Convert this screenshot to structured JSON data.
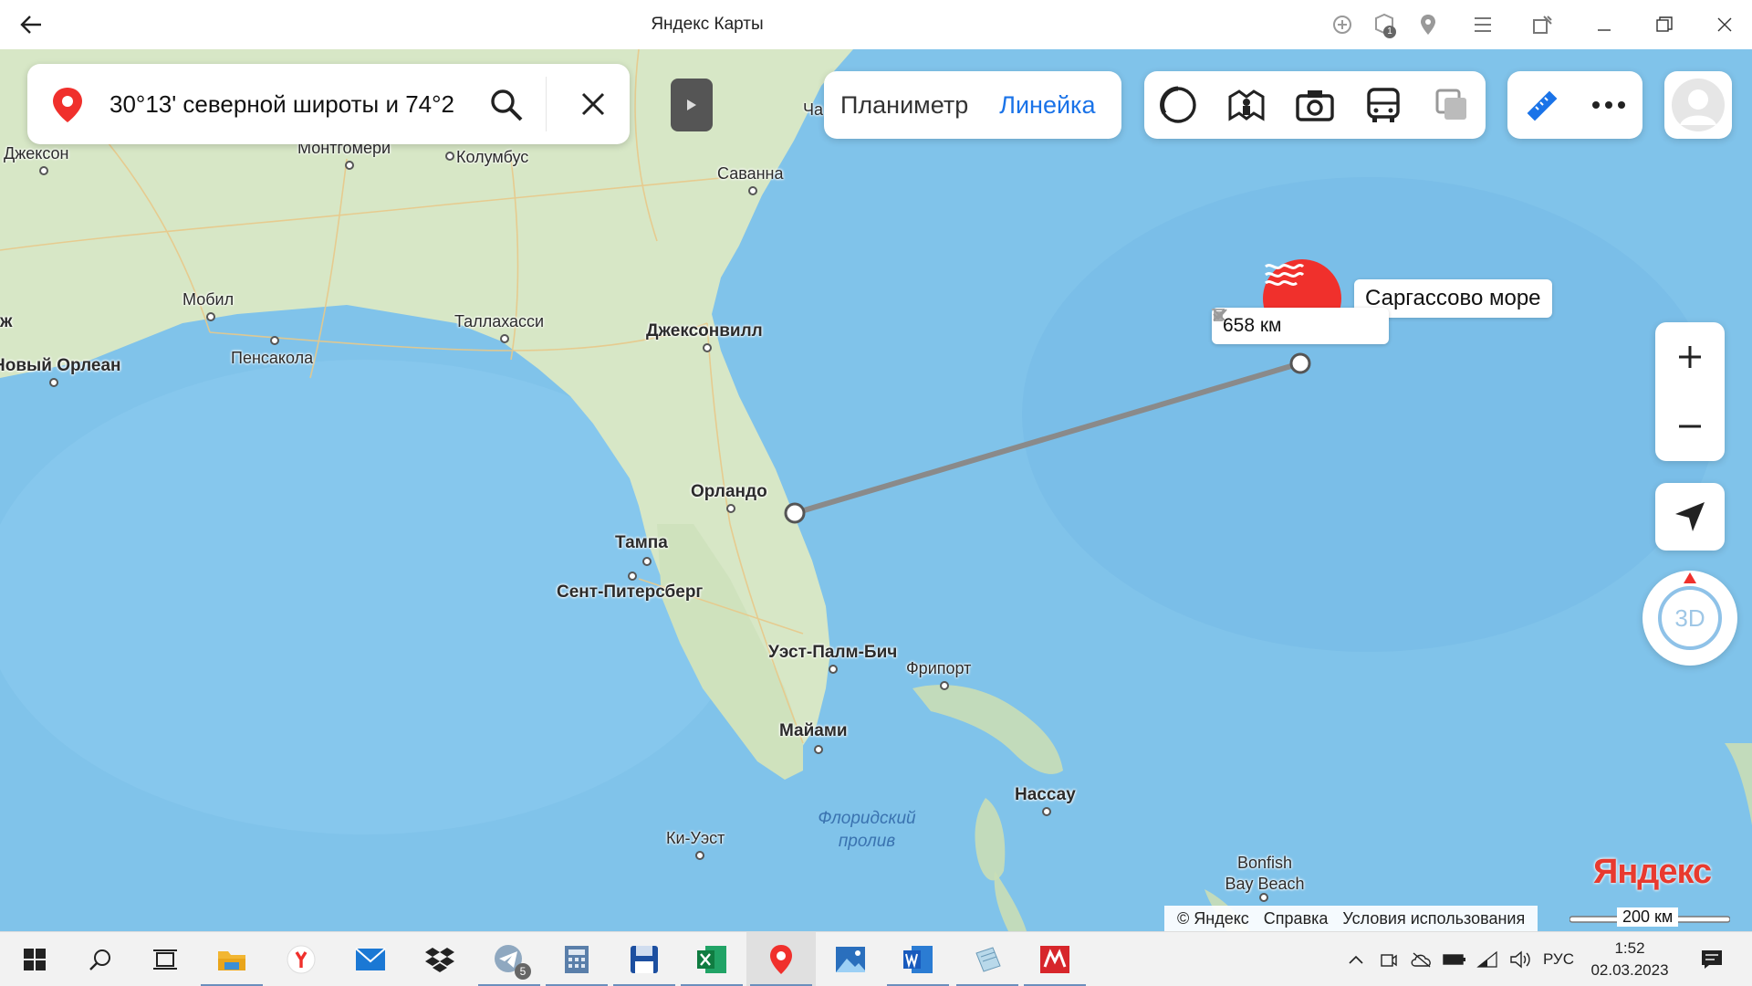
{
  "window": {
    "title": "Яндекс Карты"
  },
  "search": {
    "query": "30°13' северной широты и 74°2"
  },
  "modes": {
    "planimeter": "Планиметр",
    "ruler": "Линейка"
  },
  "ruler": {
    "distance": "658 км"
  },
  "sea": {
    "label": "Саргассово море"
  },
  "compass": {
    "label": "3D"
  },
  "cities": [
    {
      "name": "Джексон"
    },
    {
      "name": "Монтгомери"
    },
    {
      "name": "Колумбус"
    },
    {
      "name": "Саванна"
    },
    {
      "name": "Мобил"
    },
    {
      "name": "Таллахасси"
    },
    {
      "name": "Джексонвилл"
    },
    {
      "name": "Пенсакола"
    },
    {
      "name": "Новый Орлеан"
    },
    {
      "name": "Орландо"
    },
    {
      "name": "Тампа"
    },
    {
      "name": "Сент-Питерсберг"
    },
    {
      "name": "Уэст-Палм-Бич"
    },
    {
      "name": "Фрипорт"
    },
    {
      "name": "Майами"
    },
    {
      "name": "Нассау"
    },
    {
      "name": "Ки-Уэст"
    },
    {
      "name": "Bonfish Bay Beach"
    },
    {
      "name": "Ча"
    },
    {
      "name": "ж"
    }
  ],
  "water": {
    "strait": "Флоридский пролив"
  },
  "footer": {
    "copyright": "© Яндекс",
    "help": "Справка",
    "terms": "Условия использования",
    "scale": "200 км",
    "logo": "Яндекс"
  },
  "taskbar": {
    "language": "РУС",
    "time": "1:52",
    "date": "02.03.2023",
    "telegram_badge": "5",
    "title_badge": "1"
  },
  "colors": {
    "accent": "#1a73e8",
    "pin": "#f0302c",
    "logo": "#e83a2f",
    "land": "#d9e8c9",
    "water": "#7fc2ea"
  }
}
